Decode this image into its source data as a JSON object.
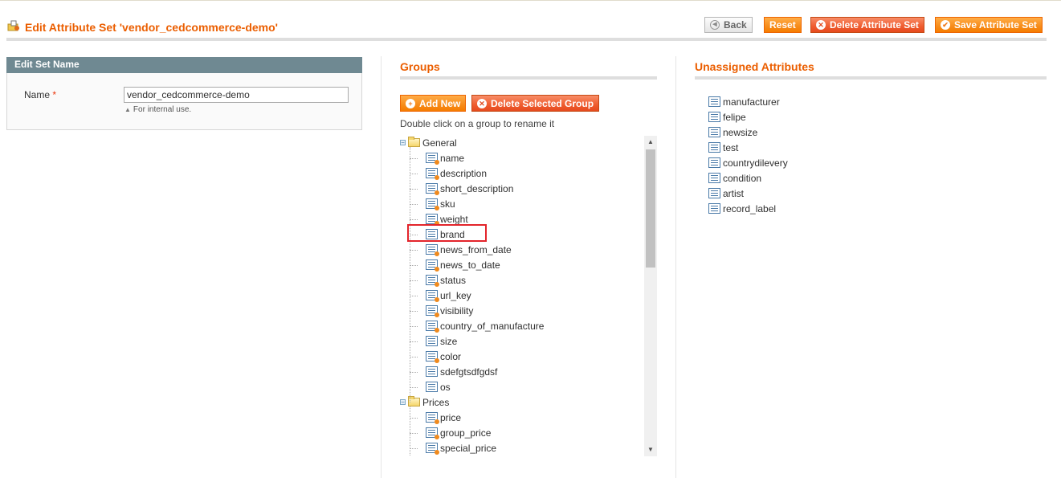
{
  "header": {
    "title": "Edit Attribute Set 'vendor_cedcommerce-demo'",
    "buttons": {
      "back": "Back",
      "reset": "Reset",
      "delete": "Delete Attribute Set",
      "save": "Save Attribute Set"
    }
  },
  "edit_set_name": {
    "heading": "Edit Set Name",
    "name_label": "Name",
    "required_mark": "*",
    "name_value": "vendor_cedcommerce-demo",
    "note": "For internal use."
  },
  "groups": {
    "title": "Groups",
    "add_new": "Add New",
    "delete_selected": "Delete Selected Group",
    "hint": "Double click on a group to rename it",
    "tree": [
      {
        "type": "group",
        "label": "General"
      },
      {
        "type": "leaf",
        "label": "name",
        "system": true
      },
      {
        "type": "leaf",
        "label": "description",
        "system": true
      },
      {
        "type": "leaf",
        "label": "short_description",
        "system": true
      },
      {
        "type": "leaf",
        "label": "sku",
        "system": true
      },
      {
        "type": "leaf",
        "label": "weight",
        "system": true
      },
      {
        "type": "leaf",
        "label": "brand",
        "system": false
      },
      {
        "type": "leaf",
        "label": "news_from_date",
        "system": true
      },
      {
        "type": "leaf",
        "label": "news_to_date",
        "system": true
      },
      {
        "type": "leaf",
        "label": "status",
        "system": true
      },
      {
        "type": "leaf",
        "label": "url_key",
        "system": true
      },
      {
        "type": "leaf",
        "label": "visibility",
        "system": true
      },
      {
        "type": "leaf",
        "label": "country_of_manufacture",
        "system": true
      },
      {
        "type": "leaf",
        "label": "size",
        "system": false
      },
      {
        "type": "leaf",
        "label": "color",
        "system": true
      },
      {
        "type": "leaf",
        "label": "sdefgtsdfgdsf",
        "system": false
      },
      {
        "type": "leaf",
        "label": "os",
        "system": false
      },
      {
        "type": "group",
        "label": "Prices"
      },
      {
        "type": "leaf",
        "label": "price",
        "system": true
      },
      {
        "type": "leaf",
        "label": "group_price",
        "system": true
      },
      {
        "type": "leaf",
        "label": "special_price",
        "system": true
      }
    ]
  },
  "unassigned": {
    "title": "Unassigned Attributes",
    "items": [
      "manufacturer",
      "felipe",
      "newsize",
      "test",
      "countrydilevery",
      "condition",
      "artist",
      "record_label"
    ]
  },
  "colors": {
    "accent": "#eb5e00",
    "button": "#f78c1a",
    "delete_button": "#ef5c2f",
    "panel_header": "#6f8992",
    "highlight": "#e3242b"
  }
}
